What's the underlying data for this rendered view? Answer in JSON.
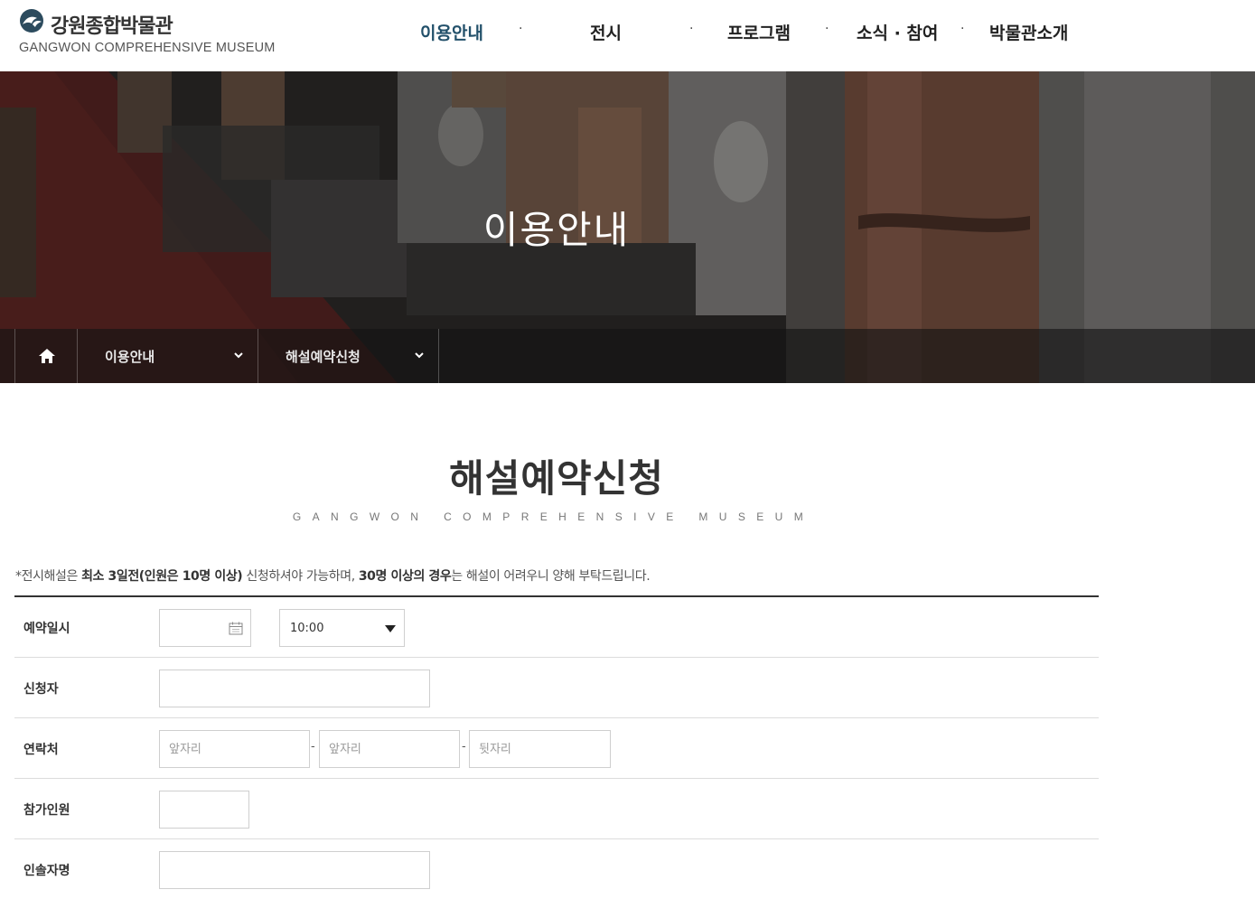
{
  "header": {
    "logo_title": "강원종합박물관",
    "logo_sub": "GANGWON COMPREHENSIVE MUSEUM",
    "nav": [
      {
        "label": "이용안내",
        "active": true
      },
      {
        "label": "전시",
        "active": false
      },
      {
        "label": "프로그램",
        "active": false
      },
      {
        "label": "소식 · 참여",
        "active": false
      },
      {
        "label": "박물관소개",
        "active": false
      }
    ],
    "nav_separator": "·",
    "accent_color": "#22506a"
  },
  "hero": {
    "title": "이용안내",
    "breadcrumb": {
      "home_icon": "home-icon",
      "level1": "이용안내",
      "level2": "해설예약신청"
    }
  },
  "main": {
    "title": "해설예약신청",
    "subtitle": "GANGWON COMPREHENSIVE MUSEUM",
    "notice": {
      "p1": "*전시해설은 ",
      "b1": "최소 3일전(인원은 10명 이상)",
      "p2": " 신청하셔야 가능하며, ",
      "b2": "30명 이상의 경우",
      "p3": "는 해설이 어려우니 양해 부탁드립니다."
    },
    "form": {
      "date_label": "예약일시",
      "date_value": "",
      "time_value": "10:00",
      "applicant_label": "신청자",
      "applicant_value": "",
      "contact_label": "연락처",
      "contact_placeholders": [
        "앞자리",
        "앞자리",
        "뒷자리"
      ],
      "contact_separator": "-",
      "people_label": "참가인원",
      "people_value": "",
      "leader_label": "인솔자명",
      "leader_value": ""
    }
  }
}
